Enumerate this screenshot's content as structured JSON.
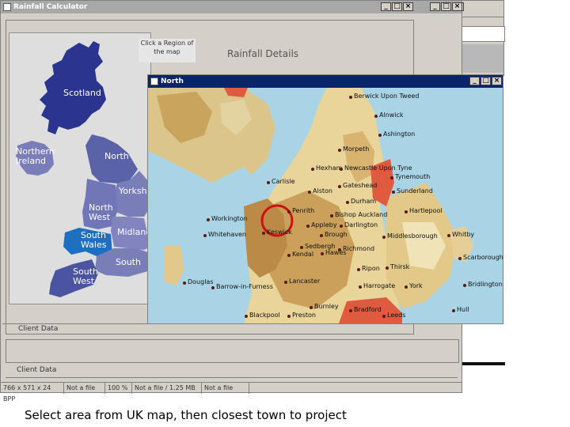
{
  "main_window": {
    "title": "Rainfall Calculator"
  },
  "hint": {
    "text": "Click a Region of the map"
  },
  "details": {
    "heading": "Rainfall Details"
  },
  "sections": {
    "client_data_1": "Client Data",
    "client_data_2": "Client Data"
  },
  "regions": {
    "scotland": "Scotland",
    "northern_ireland": "Northern Ireland",
    "north": "North",
    "yorkshire": "Yorkshi",
    "north_west": "North West",
    "south_wales": "South Wales",
    "midlands": "Midland",
    "south": "South",
    "south_west": "South West"
  },
  "north_window": {
    "title": "North"
  },
  "towns": [
    {
      "name": "Berwick Upon Tweed"
    },
    {
      "name": "Alnwick"
    },
    {
      "name": "Ashington"
    },
    {
      "name": "Morpeth"
    },
    {
      "name": "Hexham"
    },
    {
      "name": "Newcastle Upon Tyne"
    },
    {
      "name": "Tynemouth"
    },
    {
      "name": "Carlisle"
    },
    {
      "name": "Alston"
    },
    {
      "name": "Gateshead"
    },
    {
      "name": "Sunderland"
    },
    {
      "name": "Durham"
    },
    {
      "name": "Hartlepool"
    },
    {
      "name": "Penrith"
    },
    {
      "name": "Bishop Auckland"
    },
    {
      "name": "Workington"
    },
    {
      "name": "Appleby"
    },
    {
      "name": "Darlington"
    },
    {
      "name": "Whitehaven"
    },
    {
      "name": "Keswick"
    },
    {
      "name": "Brough"
    },
    {
      "name": "Middlesborough"
    },
    {
      "name": "Whitby"
    },
    {
      "name": "Sedbergh"
    },
    {
      "name": "Richmond"
    },
    {
      "name": "Kendal"
    },
    {
      "name": "Hawes"
    },
    {
      "name": "Scarborough"
    },
    {
      "name": "Ripon"
    },
    {
      "name": "Thirsk"
    },
    {
      "name": "Douglas"
    },
    {
      "name": "Barrow-in-Furness"
    },
    {
      "name": "Lancaster"
    },
    {
      "name": "Harrogate"
    },
    {
      "name": "York"
    },
    {
      "name": "Bridlington"
    },
    {
      "name": "Burnley"
    },
    {
      "name": "Bradford"
    },
    {
      "name": "Hull"
    },
    {
      "name": "Blackpool"
    },
    {
      "name": "Preston"
    },
    {
      "name": "Leeds"
    }
  ],
  "statusbar": {
    "dims": "766 x 571 x 24 BPP",
    "file": "Not a file",
    "zoom": "100 %",
    "size": "Not a file / 1.25 MB",
    "file2": "Not a file"
  },
  "caption": "Select area from UK map, then closest town to project",
  "colors": {
    "scotland": "#2b3590",
    "regions": "#6f73b8",
    "title_active": "#0a246a",
    "marker": "#cc1111"
  }
}
